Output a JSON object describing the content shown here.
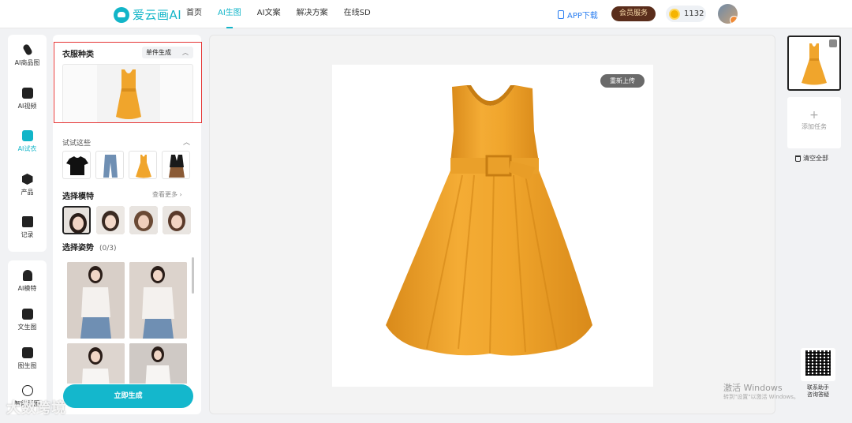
{
  "header": {
    "logo_text": "爱云画AI",
    "nav": [
      "首页",
      "AI生图",
      "AI文案",
      "解决方案",
      "在线SD"
    ],
    "active_nav": "AI生图",
    "app_download": "APP下载",
    "vip_button": "会员服务",
    "coin_balance": "1132"
  },
  "sidebar_top": [
    "AI商品图",
    "AI视频",
    "AI试衣",
    "产品",
    "记录"
  ],
  "sidebar_active": "AI试衣",
  "sidebar_bottom": [
    "AI模特",
    "文生图",
    "图生图",
    "智能拓图"
  ],
  "config": {
    "garment_title": "衣服种类",
    "single_mode": "单件生成",
    "try_these": "试试这些",
    "choose_model": "选择模特",
    "see_more": "查看更多",
    "choose_pose": "选择姿势",
    "pose_count": "(0/3)",
    "generate_button": "立即生成"
  },
  "canvas": {
    "reupload_button": "重新上传"
  },
  "right_panel": {
    "add_task": "添加任务",
    "clear_all": "清空全部",
    "qr_label_line1": "联系助手",
    "qr_label_line2": "咨询答疑"
  },
  "overlays": {
    "windows_line1": "激活 Windows",
    "windows_line2": "转到\"设置\"以激活 Windows。",
    "brand_watermark": "大数跨境"
  },
  "colors": {
    "accent": "#12b5c8",
    "dress": "#f0a52c",
    "vip_bg": "#5a2d1b",
    "highlight_box": "#e53535"
  }
}
